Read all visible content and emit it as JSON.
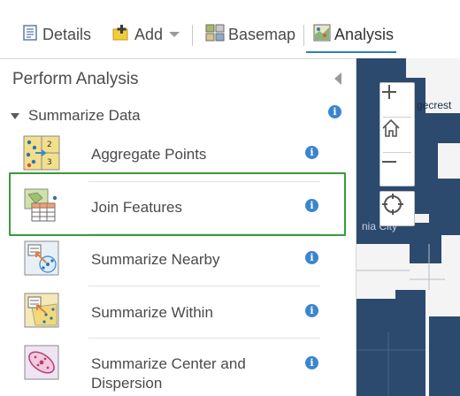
{
  "toolbar": {
    "details_label": "Details",
    "add_label": "Add",
    "basemap_label": "Basemap",
    "analysis_label": "Analysis",
    "active_tab": "Analysis",
    "accent_color": "#2f7fc1"
  },
  "panel": {
    "title": "Perform Analysis",
    "section": {
      "label": "Summarize Data",
      "expanded": true
    },
    "tools": [
      {
        "label": "Aggregate Points",
        "icon": "aggregate-points-icon"
      },
      {
        "label": "Join Features",
        "icon": "join-features-icon",
        "highlighted": true
      },
      {
        "label": "Summarize Nearby",
        "icon": "summarize-nearby-icon"
      },
      {
        "label": "Summarize Within",
        "icon": "summarize-within-icon"
      },
      {
        "label": "Summarize Center and",
        "label_line2": "Dispersion",
        "icon": "summarize-center-dispersion-icon"
      }
    ],
    "highlight_color": "#3a9a3a",
    "info_color": "#3a85d0"
  },
  "map": {
    "labels": [
      "gecrest",
      "nia City"
    ],
    "region_color": "#2c4a6e"
  }
}
